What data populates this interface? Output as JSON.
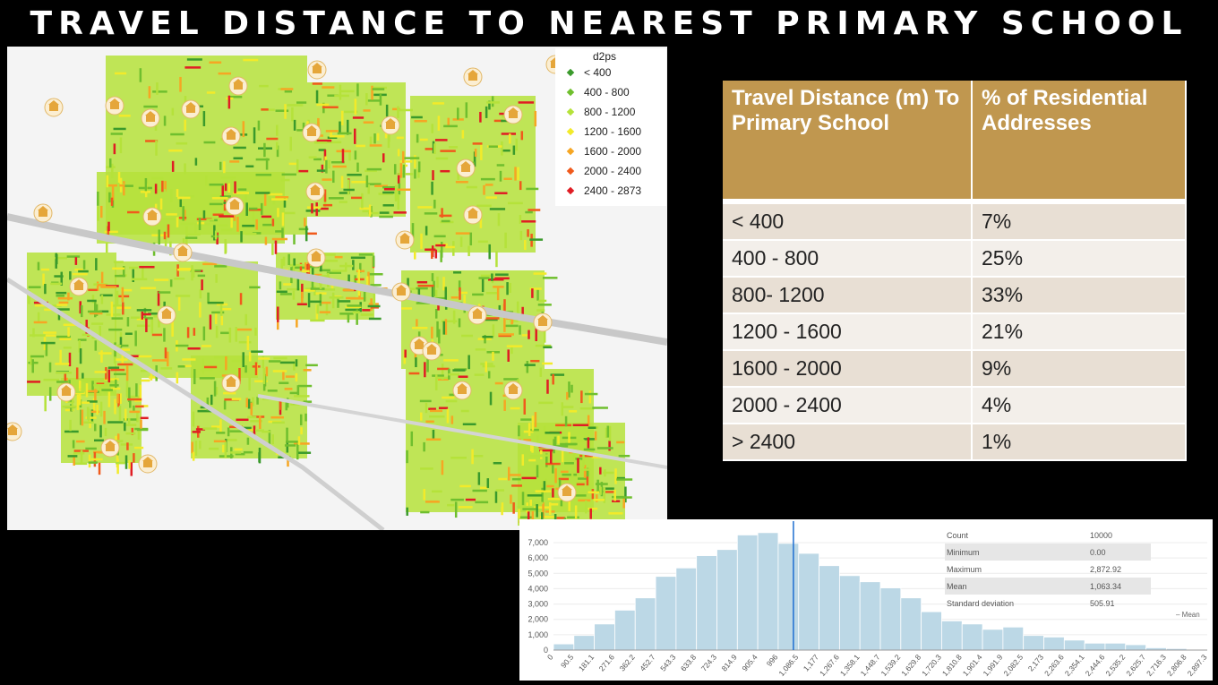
{
  "title": "TRAVEL DISTANCE TO NEAREST PRIMARY SCHOOL",
  "map": {
    "legend_title": "d2ps",
    "legend": [
      {
        "label": "< 400",
        "color": "#3a9a2c"
      },
      {
        "label": "400 - 800",
        "color": "#6fbf2e"
      },
      {
        "label": "800 - 1200",
        "color": "#b5e23a"
      },
      {
        "label": "1200 - 1600",
        "color": "#f2ea2a"
      },
      {
        "label": "1600 - 2000",
        "color": "#f6a623"
      },
      {
        "label": "2000 - 2400",
        "color": "#f05a1c"
      },
      {
        "label": "2400 - 2873",
        "color": "#e01d24"
      }
    ],
    "school_icon": "school-building-icon"
  },
  "table": {
    "headers": [
      "Travel Distance (m) To Primary School",
      "% of Residential Addresses"
    ],
    "rows": [
      [
        "< 400",
        "7%"
      ],
      [
        "400 - 800",
        "25%"
      ],
      [
        "800- 1200",
        "33%"
      ],
      [
        "1200 - 1600",
        "21%"
      ],
      [
        "1600 - 2000",
        "9%"
      ],
      [
        "2000 - 2400",
        "4%"
      ],
      [
        "> 2400",
        "1%"
      ]
    ],
    "header_color": "#c0974f"
  },
  "stats": [
    {
      "label": "Count",
      "value": "10000"
    },
    {
      "label": "Minimum",
      "value": "0.00"
    },
    {
      "label": "Maximum",
      "value": "2,872.92"
    },
    {
      "label": "Mean",
      "value": "1,063.34"
    },
    {
      "label": "Standard deviation",
      "value": "505.91"
    }
  ],
  "mean_legend": "Mean",
  "chart_data": {
    "type": "bar",
    "categories": [
      "0",
      "90.5",
      "181.1",
      "271.6",
      "362.2",
      "452.7",
      "543.3",
      "633.8",
      "724.3",
      "814.9",
      "905.4",
      "996",
      "1,086.5",
      "1,177",
      "1,267.6",
      "1,358.1",
      "1,448.7",
      "1,539.2",
      "1,629.8",
      "1,720.3",
      "1,810.8",
      "1,901.4",
      "1,991.9",
      "2,082.5",
      "2,173",
      "2,263.6",
      "2,354.1",
      "2,444.6",
      "2,535.2",
      "2,625.7",
      "2,716.3",
      "2,806.8",
      "2,897.3"
    ],
    "values": [
      400,
      950,
      1700,
      2600,
      3400,
      4800,
      5350,
      6150,
      6550,
      7500,
      7650,
      6950,
      6300,
      5500,
      4850,
      4450,
      4050,
      3400,
      2500,
      1900,
      1700,
      1350,
      1500,
      950,
      850,
      650,
      450,
      450,
      350,
      150,
      100,
      50
    ],
    "yticks": [
      "0",
      "1,000",
      "2,000",
      "3,000",
      "4,000",
      "5,000",
      "6,000",
      "7,000"
    ],
    "ylim": [
      0,
      7700
    ],
    "xlim": [
      0,
      2897.3
    ],
    "mean": 1063.34,
    "bar_color": "#bcd8e6",
    "mean_color": "#1f6fd1"
  }
}
